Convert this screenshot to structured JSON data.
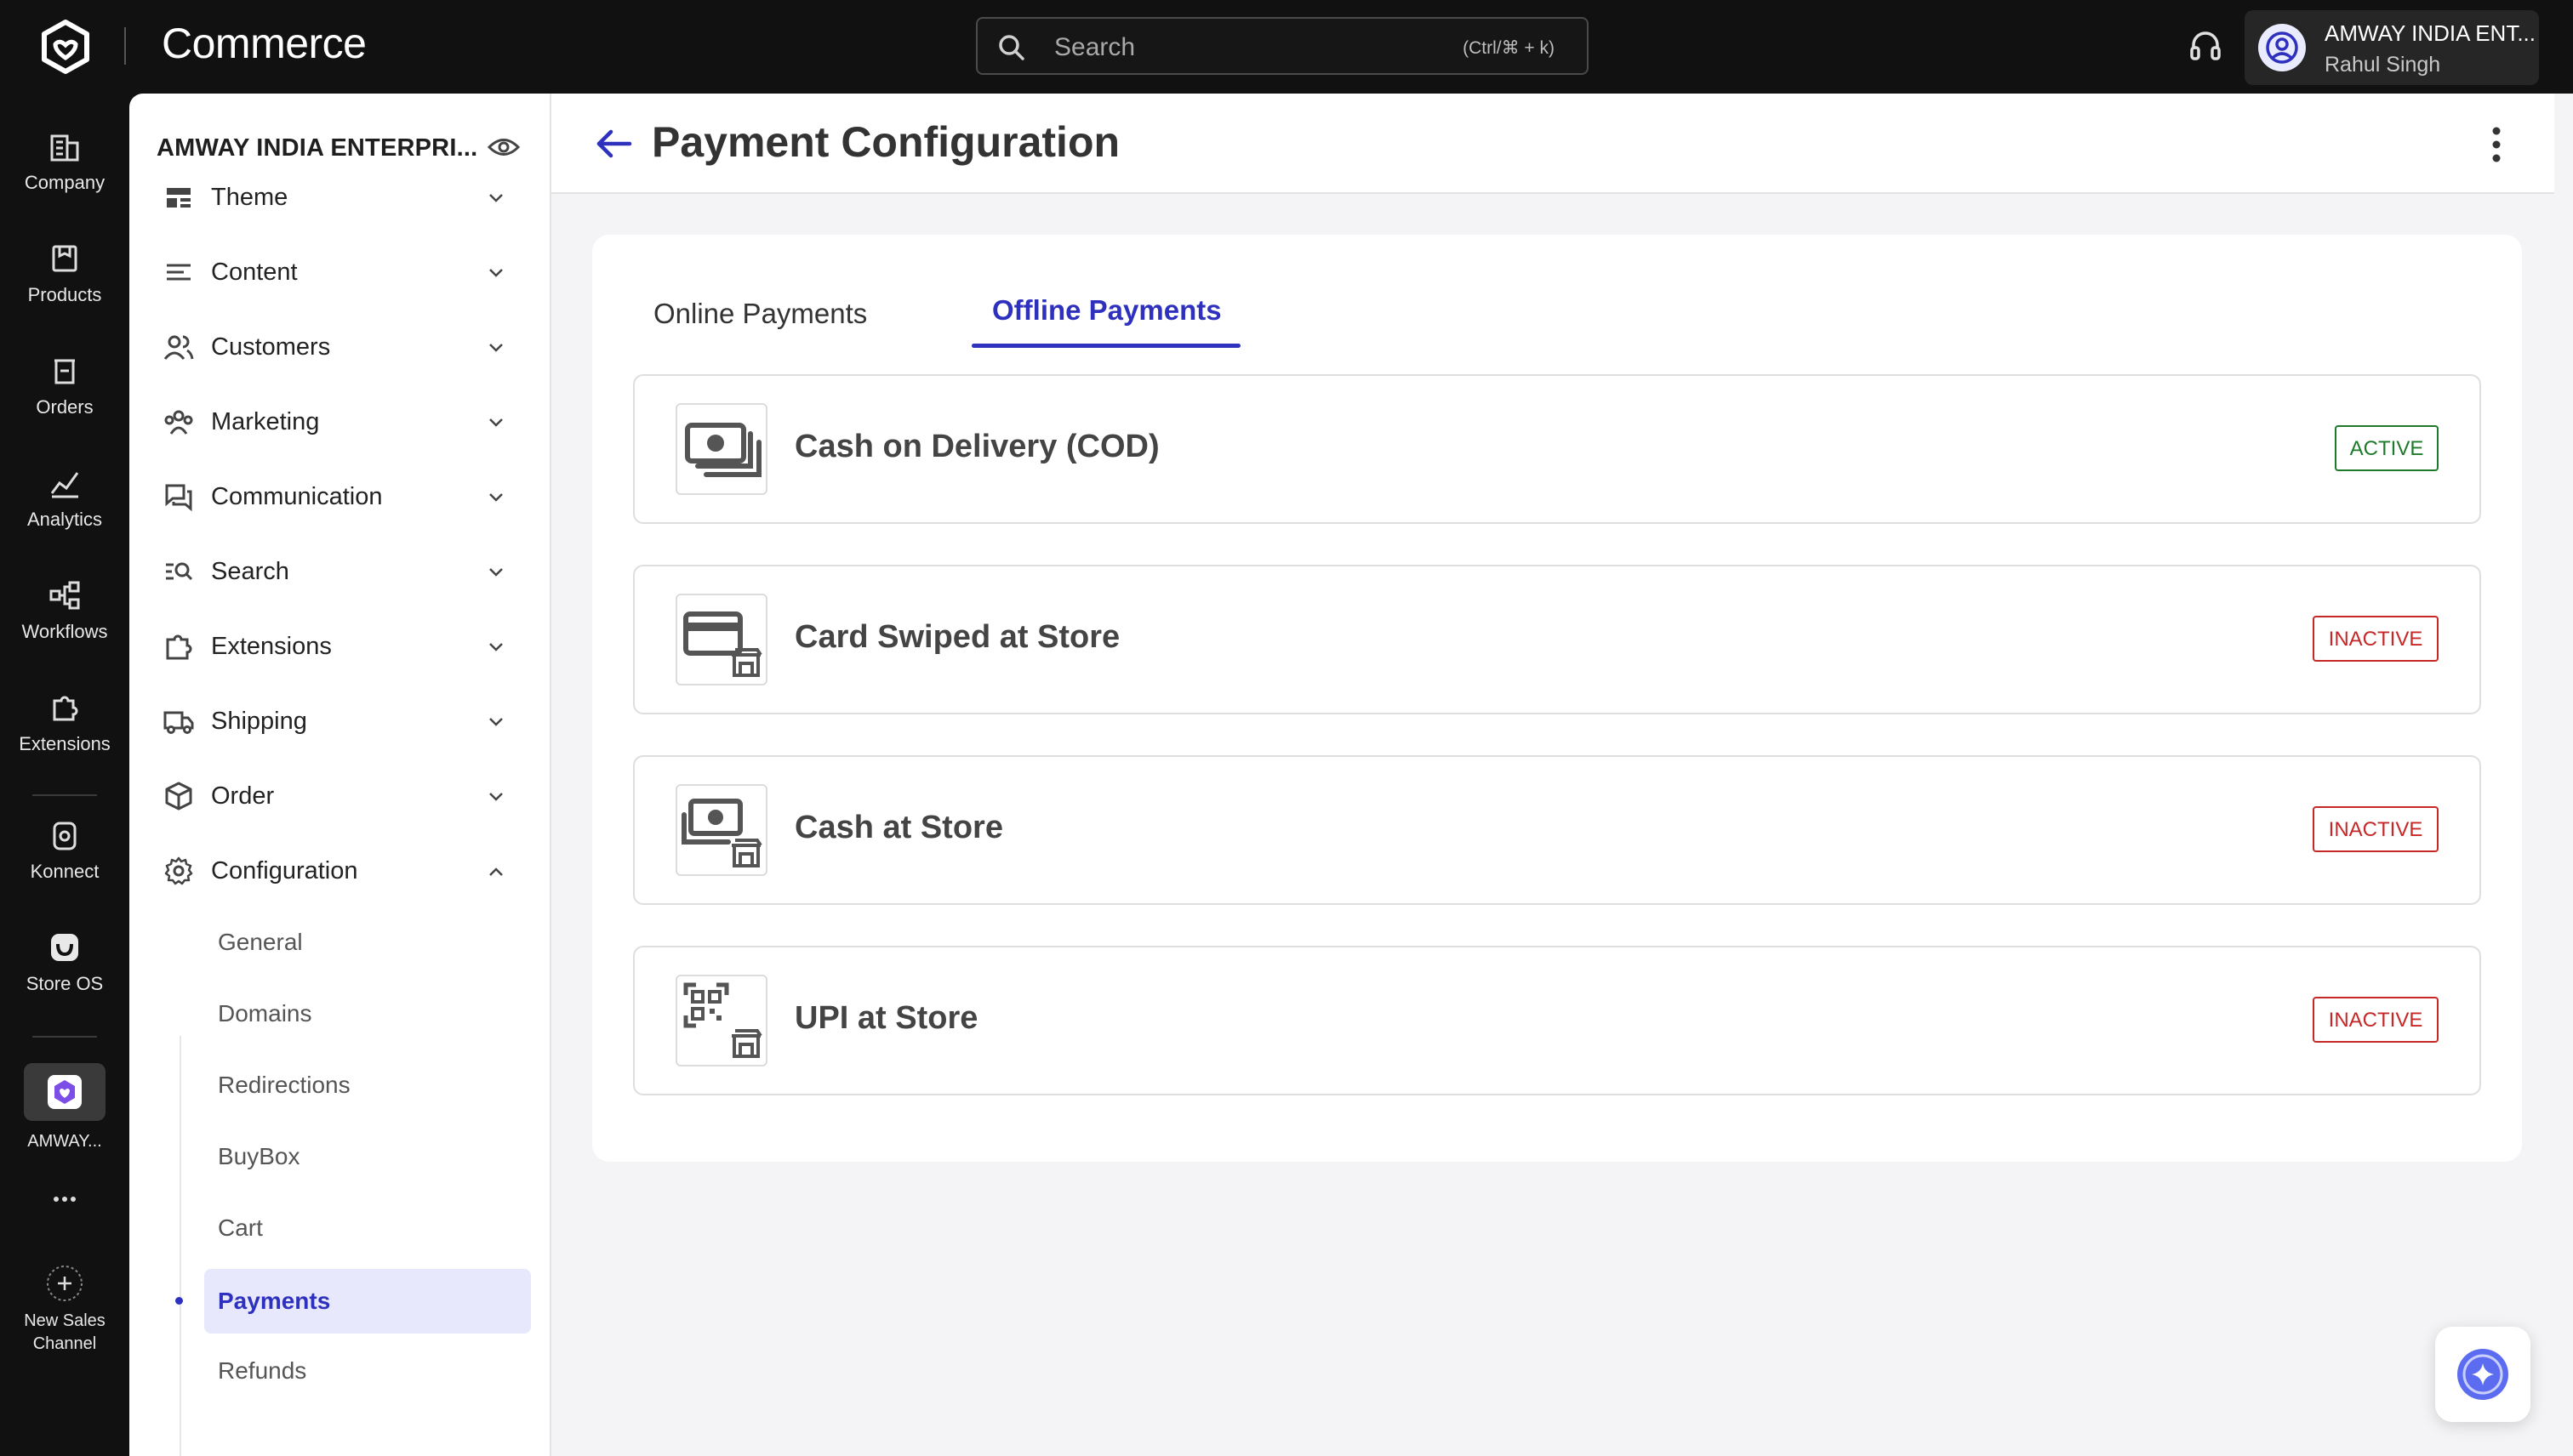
{
  "app": {
    "brand": "Commerce",
    "search_placeholder": "Search",
    "search_shortcut": "(Ctrl/⌘ + k)",
    "account_company": "AMWAY INDIA ENT...",
    "account_user": "Rahul Singh"
  },
  "rail": {
    "items": [
      {
        "label": "Company",
        "icon": "building-icon"
      },
      {
        "label": "Products",
        "icon": "box-icon"
      },
      {
        "label": "Orders",
        "icon": "orders-icon"
      },
      {
        "label": "Analytics",
        "icon": "chart-icon"
      },
      {
        "label": "Workflows",
        "icon": "workflow-icon"
      },
      {
        "label": "Extensions",
        "icon": "puzzle-icon"
      },
      {
        "label": "Konnect",
        "icon": "konnect-icon"
      },
      {
        "label": "Store OS",
        "icon": "storeos-icon"
      },
      {
        "label": "AMWAY...",
        "icon": "amway-logo"
      },
      {
        "label": "New Sales Channel",
        "icon": "plus-circle-icon"
      }
    ]
  },
  "sidebar": {
    "title": "AMWAY INDIA ENTERPRI...",
    "items": [
      {
        "label": "Theme"
      },
      {
        "label": "Content"
      },
      {
        "label": "Customers"
      },
      {
        "label": "Marketing"
      },
      {
        "label": "Communication"
      },
      {
        "label": "Search"
      },
      {
        "label": "Extensions"
      },
      {
        "label": "Shipping"
      },
      {
        "label": "Order"
      },
      {
        "label": "Configuration"
      }
    ],
    "sub_items": [
      "General",
      "Domains",
      "Redirections",
      "BuyBox",
      "Cart",
      "Payments",
      "Refunds"
    ],
    "active_sub": "Payments"
  },
  "page": {
    "title": "Payment Configuration",
    "tabs": [
      "Online Payments",
      "Offline Payments"
    ],
    "active_tab": "Offline Payments",
    "methods": [
      {
        "name": "Cash on Delivery (COD)",
        "status": "ACTIVE"
      },
      {
        "name": "Card Swiped at Store",
        "status": "INACTIVE"
      },
      {
        "name": "Cash at Store",
        "status": "INACTIVE"
      },
      {
        "name": "UPI at Store",
        "status": "INACTIVE"
      }
    ]
  },
  "colors": {
    "accent": "#2e31be",
    "active": "#1d7a2b",
    "inactive": "#c62828",
    "topbar": "#111111"
  }
}
